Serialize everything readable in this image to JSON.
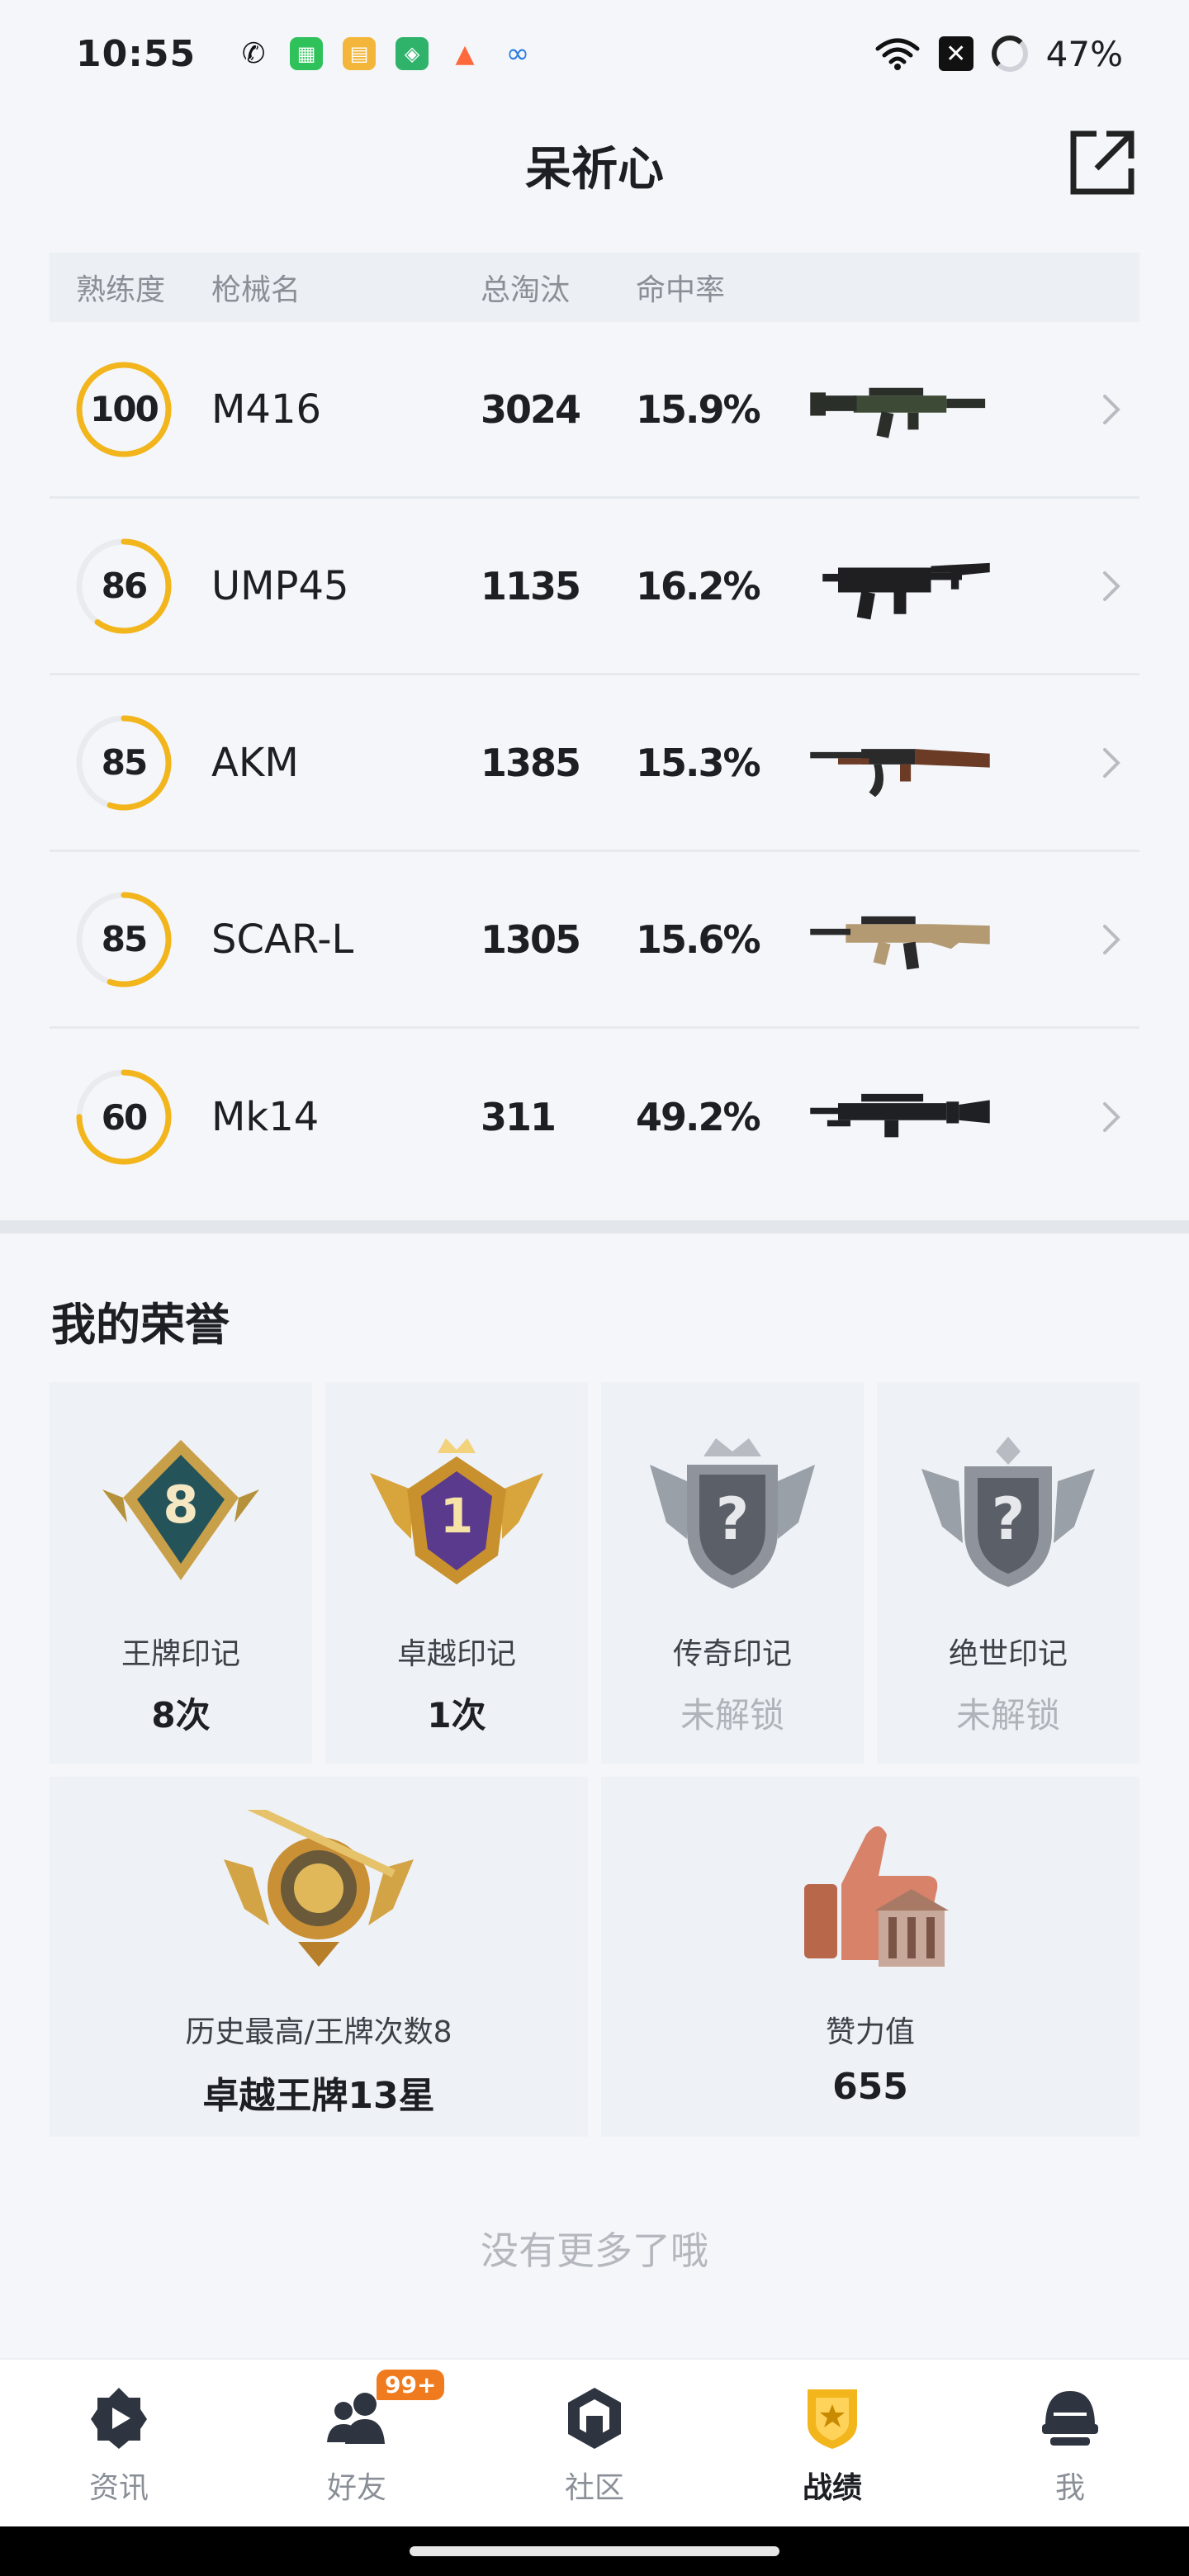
{
  "status_bar": {
    "time": "10:55",
    "battery": "47%",
    "app_icons": [
      {
        "name": "wechat-icon",
        "color": "#ffffff",
        "glyph": "✆"
      },
      {
        "name": "green-app-icon",
        "color": "#2fc25b",
        "glyph": "▦"
      },
      {
        "name": "book-app-icon",
        "color": "#f4b63a",
        "glyph": "▤"
      },
      {
        "name": "shield-app-icon",
        "color": "#2fb36b",
        "glyph": "◈"
      },
      {
        "name": "orange-app-icon",
        "color": "#ff6a3d",
        "glyph": "▲"
      },
      {
        "name": "cloud-app-icon",
        "color": "#ffffff",
        "glyph": "∞"
      }
    ]
  },
  "header": {
    "title": "呆祈心"
  },
  "table": {
    "headers": {
      "proficiency": "熟练度",
      "gun_name": "枪械名",
      "kills": "总淘汰",
      "hit_rate": "命中率"
    },
    "rows": [
      {
        "proficiency": "100",
        "level": 1.0,
        "name": "M416",
        "kills": "3024",
        "rate": "15.9%",
        "gun": "m416"
      },
      {
        "proficiency": "86",
        "level": 0.6,
        "name": "UMP45",
        "kills": "1135",
        "rate": "16.2%",
        "gun": "ump"
      },
      {
        "proficiency": "85",
        "level": 0.55,
        "name": "AKM",
        "kills": "1385",
        "rate": "15.3%",
        "gun": "akm"
      },
      {
        "proficiency": "85",
        "level": 0.55,
        "name": "SCAR-L",
        "kills": "1305",
        "rate": "15.6%",
        "gun": "scar"
      },
      {
        "proficiency": "60",
        "level": 0.75,
        "name": "Mk14",
        "kills": "311",
        "rate": "49.2%",
        "gun": "mk14"
      }
    ]
  },
  "honors": {
    "title": "我的荣誉",
    "badges": [
      {
        "label": "王牌印记",
        "value": "8次",
        "locked": false,
        "badge_text": "8"
      },
      {
        "label": "卓越印记",
        "value": "1次",
        "locked": false,
        "badge_text": "1"
      },
      {
        "label": "传奇印记",
        "value": "未解锁",
        "locked": true,
        "badge_text": "?"
      },
      {
        "label": "绝世印记",
        "value": "未解锁",
        "locked": true,
        "badge_text": "?"
      }
    ],
    "highest": {
      "label": "历史最高/王牌次数8",
      "value": "卓越王牌13星"
    },
    "effort": {
      "label": "赞力值",
      "value": "655"
    }
  },
  "footer_note": "没有更多了哦",
  "nav": {
    "items": [
      {
        "label": "资讯",
        "icon": "news-icon",
        "active": false
      },
      {
        "label": "好友",
        "icon": "friends-icon",
        "active": false,
        "badge": "99+"
      },
      {
        "label": "社区",
        "icon": "community-icon",
        "active": false
      },
      {
        "label": "战绩",
        "icon": "record-icon",
        "active": true
      },
      {
        "label": "我",
        "icon": "profile-icon",
        "active": false
      }
    ]
  },
  "colors": {
    "accent": "#f2b51c",
    "ring_track": "#e9ebee",
    "nav_badge": "#f07b1f"
  }
}
